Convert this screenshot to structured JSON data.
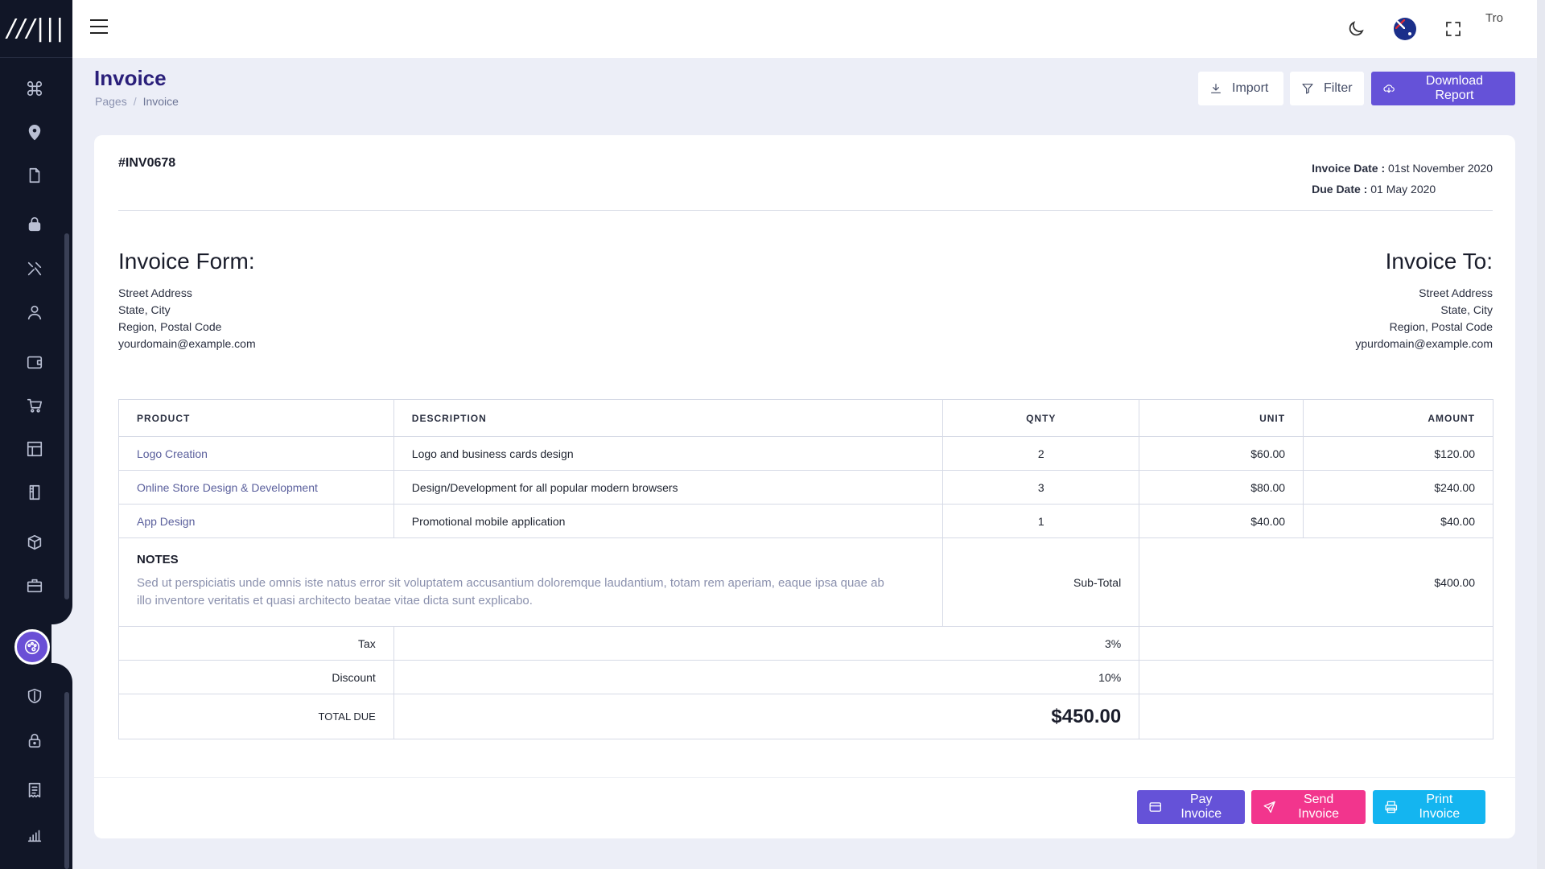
{
  "brand": {
    "logo_text": "///|||"
  },
  "topbar": {
    "avatar_alt": "Tro"
  },
  "page": {
    "title": "Invoice",
    "breadcrumb": [
      "Pages",
      "Invoice"
    ]
  },
  "actions": {
    "import": "Import",
    "filter": "Filter",
    "download": "Download Report"
  },
  "invoice": {
    "number": "#INV0678",
    "date_label": "Invoice Date :",
    "date_value": "01st November 2020",
    "due_label": "Due Date :",
    "due_value": "01 May 2020",
    "from": {
      "heading": "Invoice Form:",
      "lines": [
        "Street Address",
        "State, City",
        "Region, Postal Code",
        "yourdomain@example.com"
      ]
    },
    "to": {
      "heading": "Invoice To:",
      "lines": [
        "Street Address",
        "State, City",
        "Region, Postal Code",
        "ypurdomain@example.com"
      ]
    },
    "columns": [
      "PRODUCT",
      "DESCRIPTION",
      "QNTY",
      "UNIT",
      "AMOUNT"
    ],
    "items": [
      {
        "product": "Logo Creation",
        "description": "Logo and business cards design",
        "qty": "2",
        "unit": "$60.00",
        "amount": "$120.00"
      },
      {
        "product": "Online Store Design & Development",
        "description": "Design/Development for all popular modern browsers",
        "qty": "3",
        "unit": "$80.00",
        "amount": "$240.00"
      },
      {
        "product": "App Design",
        "description": "Promotional mobile application",
        "qty": "1",
        "unit": "$40.00",
        "amount": "$40.00"
      }
    ],
    "notes_title": "NOTES",
    "notes_text": "Sed ut perspiciatis unde omnis iste natus error sit voluptatem accusantium doloremque laudantium, totam rem aperiam, eaque ipsa quae ab illo inventore veritatis et quasi architecto beatae vitae dicta sunt explicabo.",
    "subtotal_label": "Sub-Total",
    "subtotal_value": "$400.00",
    "tax_label": "Tax",
    "tax_value": "3%",
    "discount_label": "Discount",
    "discount_value": "10%",
    "total_label": "TOTAL DUE",
    "total_value": "$450.00"
  },
  "footer": {
    "pay": "Pay Invoice",
    "send": "Send Invoice",
    "print": "Print Invoice"
  },
  "colors": {
    "primary": "#6552d8",
    "pink": "#f2358d",
    "cyan": "#14b5f0",
    "sidebar": "#111627",
    "title": "#2a1f7a"
  }
}
